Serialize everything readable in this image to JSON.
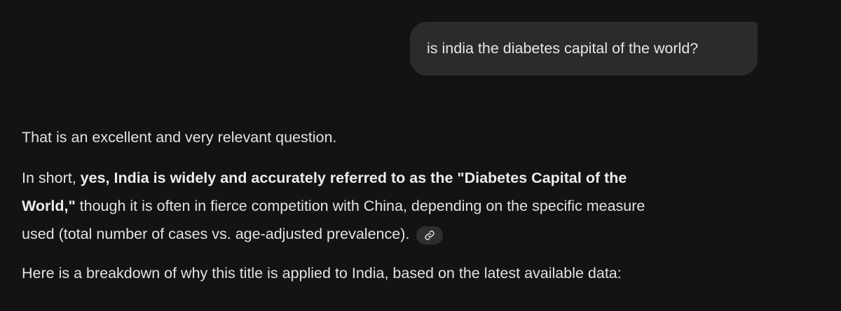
{
  "conversation": {
    "user_message": "is india the diabetes capital of the world?",
    "response": {
      "intro": "That is an excellent and very relevant question.",
      "para2": {
        "lead": "In short, ",
        "bold_part1": "yes, India is widely and accurately referred to as the \"Diabetes Capital of the",
        "bold_part2": "World,\"",
        "rest_line2": " though it is often in fierce competition with China, depending on the specific measure",
        "line3": "used (total number of cases vs. age-adjusted prevalence)."
      },
      "breakdown_intro": "Here is a breakdown of why this title is applied to India, based on the latest available data:"
    }
  },
  "icons": {
    "source_link": "link-icon"
  }
}
